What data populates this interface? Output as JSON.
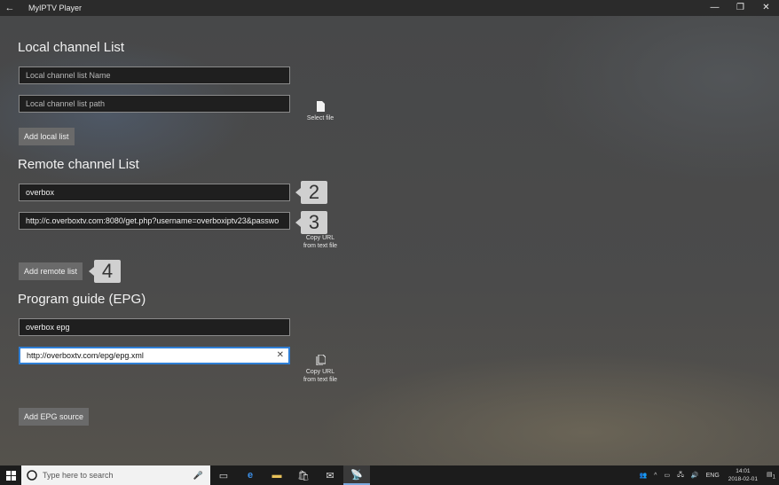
{
  "window": {
    "title": "MyIPTV Player",
    "back_icon": "←",
    "minimize": "—",
    "restore": "❐",
    "close": "✕"
  },
  "local": {
    "heading": "Local channel List",
    "name_placeholder": "Local channel list Name",
    "path_placeholder": "Local channel list path",
    "select_file_label": "Select file",
    "add_button": "Add local list"
  },
  "remote": {
    "heading": "Remote channel List",
    "name_value": "overbox",
    "url_value": "http://c.overboxtv.com:8080/get.php?username=overboxiptv23&passwo",
    "copy_url_label": "Copy URL from text file",
    "add_button": "Add remote list"
  },
  "epg": {
    "heading": "Program guide (EPG)",
    "name_value": "overbox epg",
    "url_value": "http://overboxtv.com/epg/epg.xml",
    "clear_icon": "✕",
    "copy_url_label": "Copy URL from text file",
    "add_button": "Add EPG source"
  },
  "callouts": [
    "2",
    "3",
    "4"
  ],
  "taskbar": {
    "search_placeholder": "Type here to search",
    "language": "ENG",
    "time": "14:01",
    "date": "2018-02-01",
    "notification_count": "1"
  },
  "colors": {
    "accent": "#2f7fd6",
    "callout_bg": "#d0d0d0",
    "field_bg": "#1f1f1f"
  }
}
